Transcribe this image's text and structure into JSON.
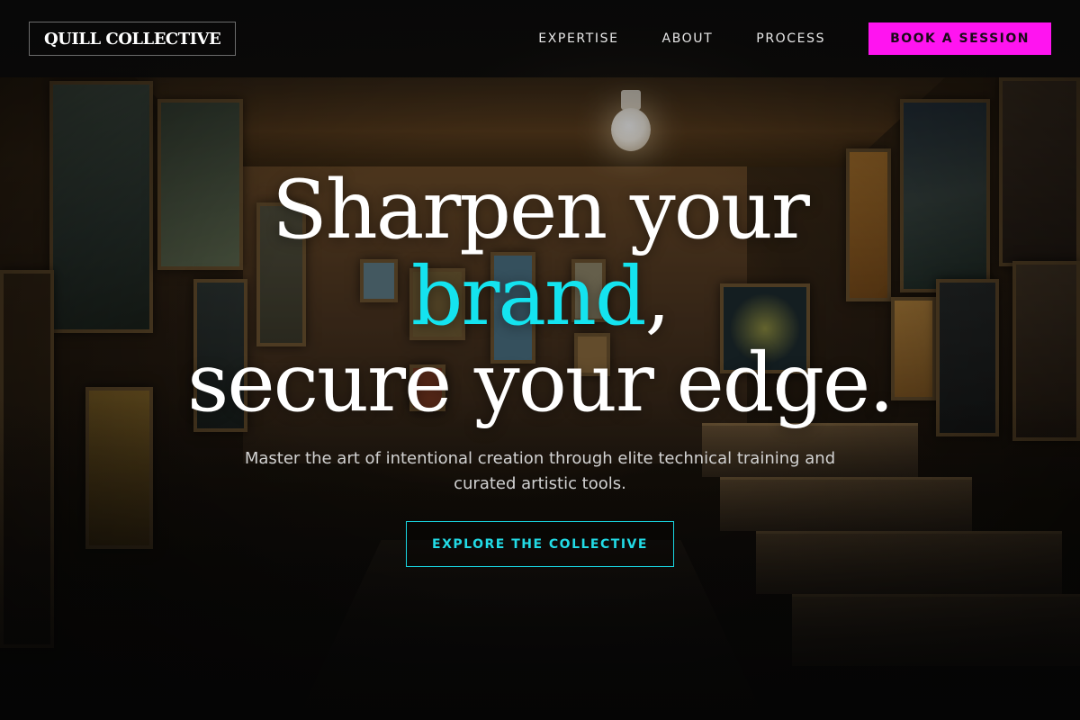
{
  "brand": {
    "name": "QUILL COLLECTIVE"
  },
  "nav": {
    "links": [
      "EXPERTISE",
      "ABOUT",
      "PROCESS"
    ],
    "cta_label": "BOOK A SESSION"
  },
  "hero": {
    "headline_line1": "Sharpen your",
    "headline_accent": "brand",
    "headline_comma": ",",
    "headline_line3": "secure your edge.",
    "subtitle": "Master the art of intentional creation through elite technical training and curated artistic tools.",
    "cta_label": "EXPLORE THE COLLECTIVE"
  },
  "colors": {
    "accent_cyan": "#14e3ef",
    "accent_magenta": "#ff14f0",
    "nav_background": "#080808"
  },
  "background": {
    "description_icon": "art-studio-photo"
  }
}
